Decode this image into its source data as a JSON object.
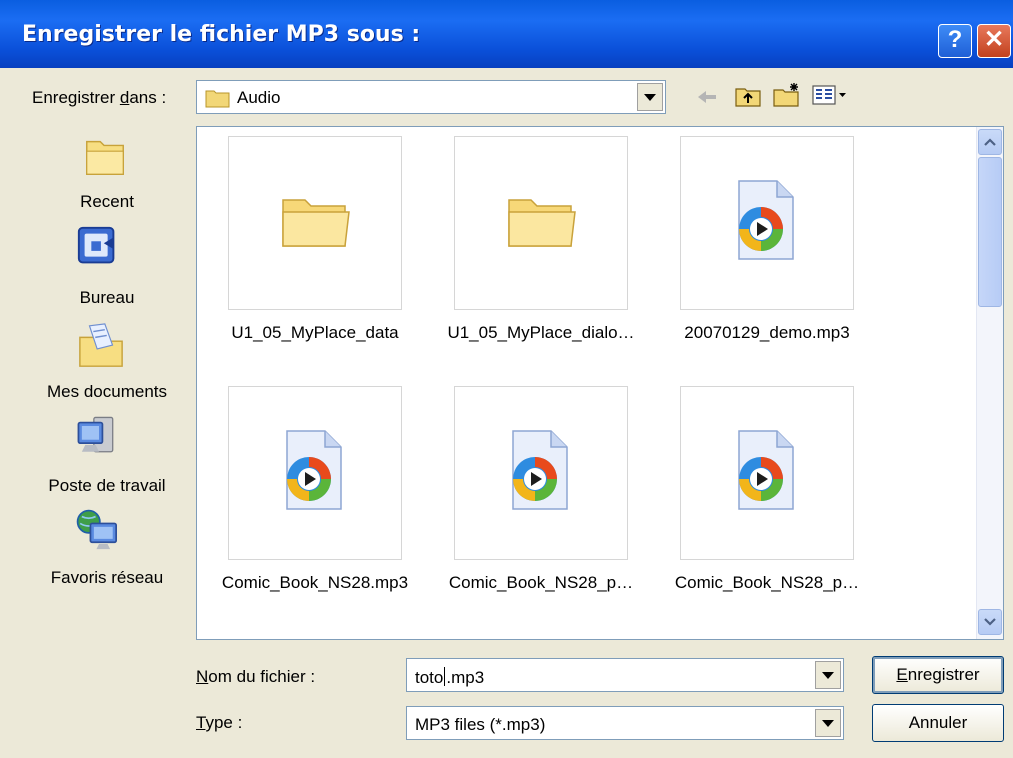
{
  "window": {
    "title": "Enregistrer le fichier MP3 sous :",
    "help_symbol": "?",
    "close_symbol": "✕"
  },
  "toolbar": {
    "save_in_label_prefix": "Enregistrer ",
    "save_in_label_accel": "d",
    "save_in_label_suffix": "ans :",
    "current_folder": "Audio"
  },
  "places": [
    {
      "label": "Recent",
      "icon": "recent-icon"
    },
    {
      "label": "Bureau",
      "icon": "desktop-icon"
    },
    {
      "label": "Mes documents",
      "icon": "my-documents-icon"
    },
    {
      "label": "Poste de travail",
      "icon": "my-computer-icon"
    },
    {
      "label": "Favoris réseau",
      "icon": "network-places-icon"
    }
  ],
  "files": [
    {
      "name": "U1_05_MyPlace_data",
      "type": "folder"
    },
    {
      "name": "U1_05_MyPlace_dialo…",
      "type": "folder"
    },
    {
      "name": "20070129_demo.mp3",
      "type": "mp3"
    },
    {
      "name": "Comic_Book_NS28.mp3",
      "type": "mp3"
    },
    {
      "name": "Comic_Book_NS28_p…",
      "type": "mp3"
    },
    {
      "name": "Comic_Book_NS28_p…",
      "type": "mp3"
    }
  ],
  "filename": {
    "label_accel": "N",
    "label_rest": "om du fichier :",
    "value_before_caret": "toto",
    "value_after_caret": ".mp3"
  },
  "filetype": {
    "label_accel": "T",
    "label_rest": "ype :",
    "value": "MP3 files (*.mp3)"
  },
  "buttons": {
    "save_accel": "E",
    "save_rest": "nregistrer",
    "cancel": "Annuler"
  },
  "colors": {
    "titlebar": "#0a5ee0",
    "dialog_bg": "#ece9d8",
    "folder": "#f2d777"
  }
}
